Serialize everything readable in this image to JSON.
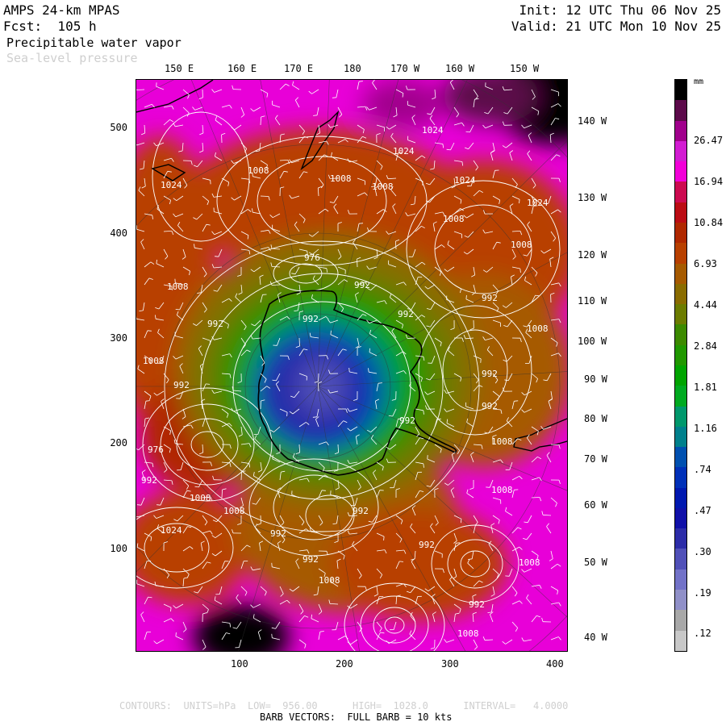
{
  "header": {
    "model": "AMPS 24-km MPAS",
    "fcst": "Fcst:  105 h",
    "field1": "Precipitable water vapor",
    "field2": "Sea-level pressure",
    "init": "Init: 12 UTC Thu 06 Nov 25",
    "valid": "Valid: 21 UTC Mon 10 Nov 25"
  },
  "top_longitudes": [
    "150 E",
    "160 E",
    "170 E",
    "180",
    "170 W",
    "160 W",
    "150 W"
  ],
  "right_longitudes": [
    "140 W",
    "130 W",
    "120 W",
    "110 W",
    "100 W",
    "90 W",
    "80 W",
    "70 W",
    "60 W",
    "50 W",
    "40 W"
  ],
  "x_ticks": [
    "100",
    "200",
    "300",
    "400"
  ],
  "y_ticks": [
    "500",
    "400",
    "300",
    "200",
    "100"
  ],
  "colorbar": {
    "unit": "mm",
    "labels": [
      "26.47",
      "16.94",
      "10.84",
      "6.93",
      "4.44",
      "2.84",
      "1.81",
      "1.16",
      ".74",
      ".47",
      ".30",
      ".19",
      ".12"
    ],
    "colors": [
      "#000000",
      "#5c0a4a",
      "#a0008c",
      "#d21cd2",
      "#f200d8",
      "#cc0a50",
      "#bb0c14",
      "#b02800",
      "#b84000",
      "#a65a00",
      "#8a6c00",
      "#6c7c00",
      "#3c8a00",
      "#209800",
      "#00a400",
      "#00aa20",
      "#00986c",
      "#00808c",
      "#0050b0",
      "#0030b8",
      "#0018b0",
      "#1010a8",
      "#2c2ca8",
      "#5050b8",
      "#7272c8",
      "#9090c8",
      "#a8a8a8",
      "#c8c8c8"
    ]
  },
  "pressure_labels": [
    "1024",
    "1024",
    "1024",
    "1024",
    "1024",
    "1024",
    "1008",
    "1008",
    "1008",
    "1008",
    "1008",
    "1008",
    "1008",
    "1008",
    "1008",
    "1008",
    "1008",
    "1008",
    "1008",
    "1008",
    "1008",
    "976",
    "992",
    "992",
    "992",
    "992",
    "992",
    "992",
    "992",
    "992",
    "992",
    "992",
    "992",
    "992",
    "992",
    "992",
    "992",
    "976"
  ],
  "footer": {
    "contours": "CONTOURS:  UNITS=hPa  LOW=  956.00      HIGH=  1028.0      INTERVAL=   4.0000",
    "barbs": "BARB VECTORS:  FULL BARB = 10 kts"
  }
}
